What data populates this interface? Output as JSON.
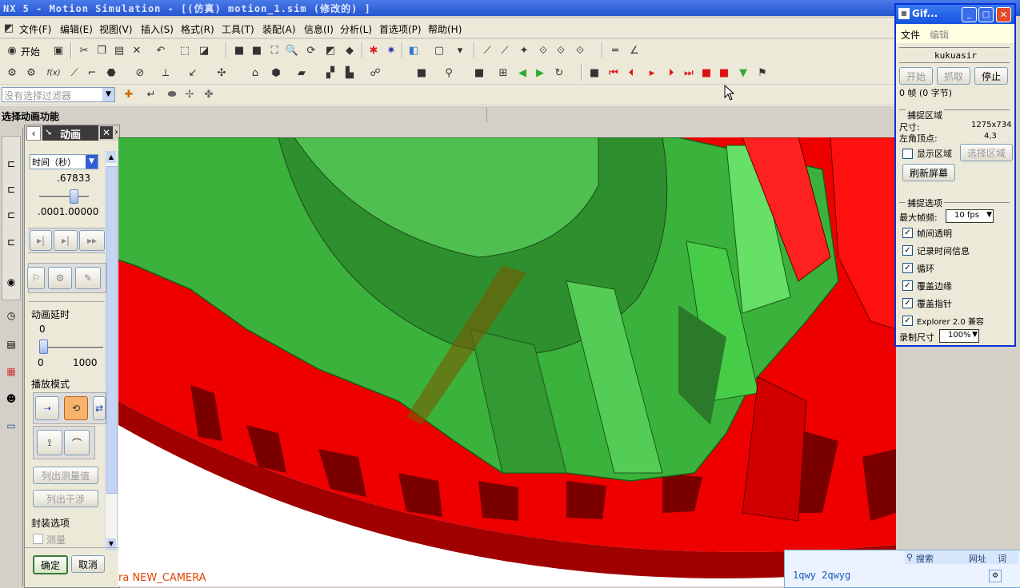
{
  "window": {
    "title": "NX 5 - Motion Simulation - [(仿真) motion_1.sim  (修改的) ]"
  },
  "menu": [
    "文件(F)",
    "编辑(E)",
    "视图(V)",
    "插入(S)",
    "格式(R)",
    "工具(T)",
    "装配(A)",
    "信息(I)",
    "分析(L)",
    "首选项(P)",
    "帮助(H)"
  ],
  "toolbar": {
    "start_label": "开始"
  },
  "filter": {
    "placeholder": "没有选择过滤器"
  },
  "status": {
    "prompt": "选择动画功能"
  },
  "panel": {
    "title": "动画",
    "time_select": "时间（秒）",
    "time_value": ".67833",
    "time_min": ".000",
    "time_max": "1.00000",
    "delay_label": "动画延时",
    "delay_value": "0",
    "delay_min": "0",
    "delay_max": "1000",
    "play_mode_label": "播放模式",
    "list_measure": "列出测量值",
    "list_interference": "列出干涉",
    "package_label": "封装选项",
    "measure_label": "测量",
    "ok_label": "确定",
    "cancel_label": "取消",
    "slider_fraction": 0.67833
  },
  "viewport": {
    "camera_label": "ra NEW_CAMERA"
  },
  "gif": {
    "title": "Gif...",
    "menu_file": "文件",
    "menu_edit": "编辑",
    "user": "kukuasir",
    "btn_start": "开始",
    "btn_capture": "抓取",
    "btn_stop": "停止",
    "frames": "0 帧 (0 字节)",
    "capture_area_label": "捕捉区域",
    "size_label": "尺寸:",
    "size_value": "1275x734",
    "corner_label": "左角顶点:",
    "corner_value": "4,3",
    "show_area": "显示区域",
    "select_area": "选择区域",
    "refresh": "刷新屏幕",
    "options_label": "捕捉选项",
    "max_fps_label": "最大帧频:",
    "max_fps_value": "10 fps",
    "opt_transparent": "帧间透明",
    "opt_time": "记录时间信息",
    "opt_loop": "循环",
    "opt_edge": "覆盖边缘",
    "opt_cursor": "覆盖指针",
    "opt_explorer": "Explorer 2.0 兼容",
    "rec_size_label": "录制尺寸",
    "rec_size_value": "100%"
  },
  "ime": {
    "search": "搜索",
    "url": "网址",
    "word": "词",
    "input": "1qwy 2qwyg"
  },
  "colors": {
    "gear_red": "#ff0000",
    "gear_green": "#33cc33",
    "title_blue": "#2454d0"
  }
}
